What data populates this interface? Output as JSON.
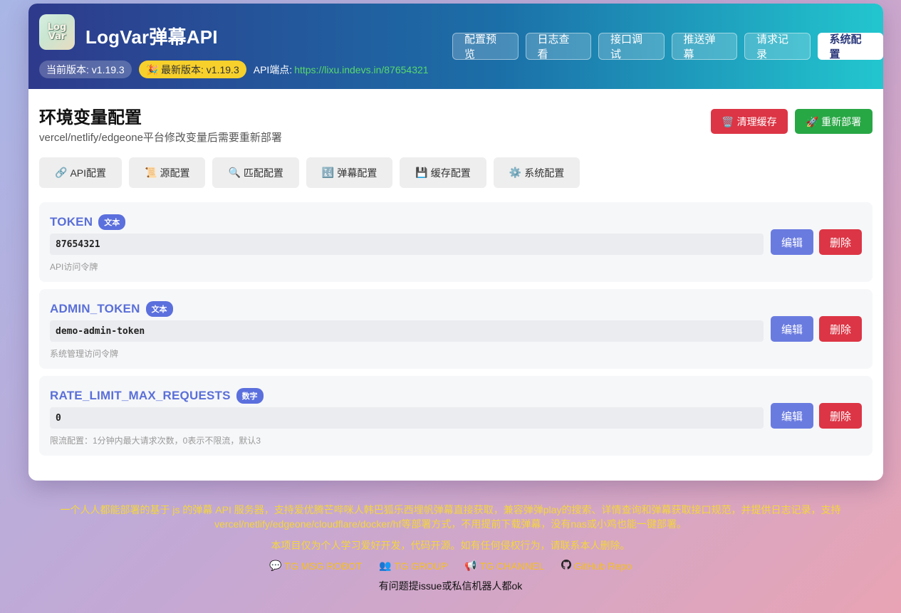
{
  "header": {
    "logo_text": "LogVar",
    "title": "LogVar弹幕API",
    "current_version": "当前版本: v1.19.3",
    "latest_version": "🎉 最新版本: v1.19.3",
    "api_label": "API端点:",
    "api_url": "https://lixu.indevs.in/87654321",
    "nav": [
      {
        "label": "配置预览"
      },
      {
        "label": "日志查看"
      },
      {
        "label": "接口调试"
      },
      {
        "label": "推送弹幕"
      },
      {
        "label": "请求记录"
      },
      {
        "label": "系统配置",
        "active": true
      }
    ]
  },
  "section": {
    "title": "环境变量配置",
    "subtitle": "vercel/netlify/edgeone平台修改变量后需要重新部署",
    "clear_cache": "🗑️ 清理缓存",
    "redeploy": "🚀 重新部署"
  },
  "tabs": [
    {
      "icon": "🔗",
      "label": "API配置"
    },
    {
      "icon": "📜",
      "label": "源配置"
    },
    {
      "icon": "🔍",
      "label": "匹配配置"
    },
    {
      "icon": "🔣",
      "label": "弹幕配置"
    },
    {
      "icon": "💾",
      "label": "缓存配置"
    },
    {
      "icon": "⚙️",
      "label": "系统配置"
    }
  ],
  "variables": [
    {
      "key": "TOKEN",
      "type": "文本",
      "value": "87654321",
      "desc": "API访问令牌",
      "edit": "编辑",
      "delete": "删除"
    },
    {
      "key": "ADMIN_TOKEN",
      "type": "文本",
      "value": "demo-admin-token",
      "desc": "系统管理访问令牌",
      "edit": "编辑",
      "delete": "删除"
    },
    {
      "key": "RATE_LIMIT_MAX_REQUESTS",
      "type": "数字",
      "value": "0",
      "desc": "限流配置：1分钟内最大请求次数，0表示不限流，默认3",
      "edit": "编辑",
      "delete": "删除"
    }
  ],
  "footer": {
    "description": "一个人人都能部署的基于 js 的弹幕 API 服务器，支持爱优腾芒哔咪人韩巴狐乐西埋帆弹幕直接获取，兼容弹弹play的搜索、详情查询和弹幕获取接口规范，并提供日志记录，支持vercel/netlify/edgeone/cloudflare/docker/hf等部署方式，不用提前下载弹幕，没有nas或小鸡也能一键部署。",
    "disclaimer": "本项目仅为个人学习爱好开发，代码开源。如有任何侵权行为，请联系本人删除。",
    "links": [
      {
        "icon": "💬",
        "label": "TG MSG ROBOT"
      },
      {
        "icon": "👥",
        "label": "TG GROUP"
      },
      {
        "icon": "📢",
        "label": "TG CHANNEL"
      },
      {
        "icon": "github-icon",
        "label": "GitHub Repo"
      }
    ],
    "help": "有问题提issue或私信机器人都ok"
  }
}
